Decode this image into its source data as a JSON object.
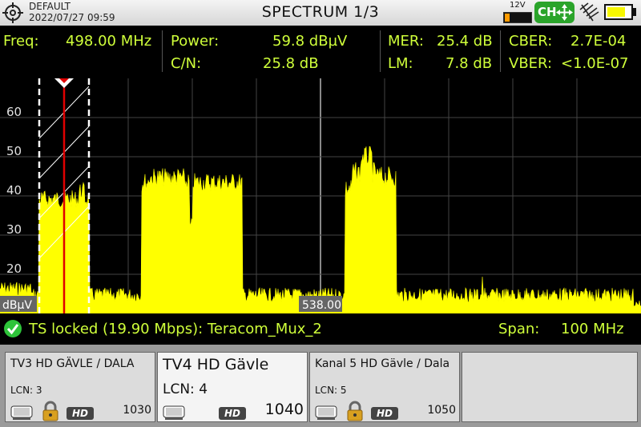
{
  "header": {
    "preset": "DEFAULT",
    "datetime": "2022/07/27 09:59",
    "title": "SPECTRUM 1/3",
    "voltage": "12V",
    "ch_button": "CH",
    "battery_level": 0.8,
    "ext_supply_level": 0.2,
    "colors": {
      "accent_green": "#2aa42a",
      "battery": "#f7f700",
      "ext_supply": "#ff9a00"
    },
    "icons": [
      "crosshair-icon",
      "move-arrows-icon",
      "antenna-icon",
      "battery-icon"
    ]
  },
  "measurements": {
    "freq_label": "Freq:",
    "freq_value": "498.00 MHz",
    "power_label": "Power:",
    "power_value": "59.8 dBµV",
    "cn_label": "C/N:",
    "cn_value": "25.8 dB",
    "mer_label": "MER:",
    "mer_value": "25.4 dB",
    "lm_label": "LM:",
    "lm_value": "7.8 dB",
    "cber_label": "CBER:",
    "cber_value": "2.7E-04",
    "vber_label": "VBER:",
    "vber_value": "<1.0E-07",
    "color": "#cfff3a"
  },
  "spectrum": {
    "y_ticks": [
      "20",
      "30",
      "40",
      "50",
      "60"
    ],
    "unit_label": "dBµV",
    "center_label": "538.00",
    "trace_color": "#ffff00",
    "marker_color": "#e00000"
  },
  "status": {
    "ts_text": "TS locked (19.90 Mbps): Teracom_Mux_2",
    "span_label": "Span:",
    "span_value": "100 MHz",
    "ok_icon": "check-icon"
  },
  "services": [
    {
      "name": "TV3 HD GÄVLE / DALA",
      "lcn": "LCN: 3",
      "sid": "1030",
      "selected": false,
      "icons": [
        "tv-icon",
        "lock-icon",
        "hd-icon"
      ],
      "hd_label": "HD"
    },
    {
      "name": "TV4 HD Gävle",
      "lcn": "LCN: 4",
      "sid": "1040",
      "selected": true,
      "icons": [
        "tv-icon",
        "hd-icon"
      ],
      "hd_label": "HD"
    },
    {
      "name": "Kanal 5 HD Gävle / Dala",
      "lcn": "LCN: 5",
      "sid": "1050",
      "selected": false,
      "icons": [
        "tv-icon",
        "lock-icon",
        "hd-icon"
      ],
      "hd_label": "HD"
    }
  ]
}
